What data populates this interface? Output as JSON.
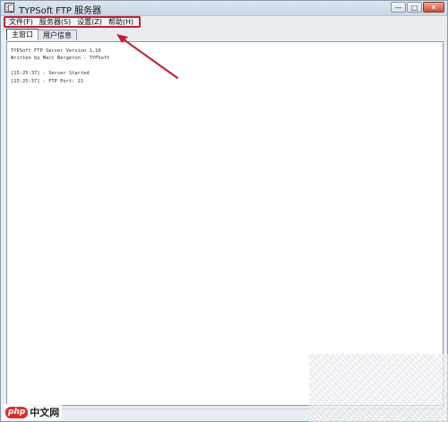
{
  "window": {
    "title": "TYPSoft FTP 服务器",
    "app_icon_glyph": "汇",
    "buttons": {
      "minimize": "—",
      "maximize": "□",
      "close": "✕"
    }
  },
  "menubar": {
    "items": [
      {
        "label": "文件(F)"
      },
      {
        "label": "服务器(S)"
      },
      {
        "label": "设置(Z)"
      },
      {
        "label": "帮助(H)"
      }
    ]
  },
  "tabs": [
    {
      "label": "主窗口",
      "active": true
    },
    {
      "label": "用户信息",
      "active": false
    }
  ],
  "log": {
    "lines": [
      "TYPSoft FTP Server Version 1.10",
      "Written by Marc Bergeron - TYPSoft",
      "",
      "[15:25:37] - Server Started",
      "[15:25:37] - FTP Port: 21"
    ]
  },
  "watermark": {
    "php": "php",
    "site": "中文网"
  },
  "colors": {
    "annotation_red": "#c2203a",
    "watermark_red": "#d9302b"
  }
}
